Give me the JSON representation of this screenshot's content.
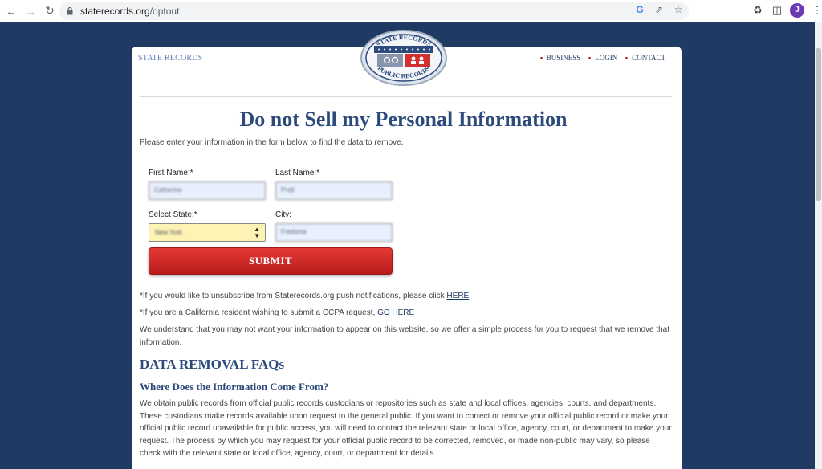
{
  "browser": {
    "url_domain": "staterecords.org",
    "url_path": "/optout",
    "avatar_initial": "J"
  },
  "header": {
    "site_name": "STATE RECORDS",
    "logo_top_text": "STATE RECORDS",
    "logo_bottom_text": "PUBLIC RECORDS",
    "nav": [
      {
        "label": "BUSINESS"
      },
      {
        "label": "LOGIN"
      },
      {
        "label": "CONTACT"
      }
    ]
  },
  "main": {
    "title": "Do not Sell my Personal Information",
    "intro": "Please enter your information in the form below to find the data to remove.",
    "form": {
      "first_name_label": "First Name:*",
      "first_name_value": "Catherine",
      "last_name_label": "Last Name:*",
      "last_name_value": "Pratt",
      "state_label": "Select State:*",
      "state_value": "New York",
      "city_label": "City:",
      "city_value": "Fredonia",
      "submit_label": "SUBMIT"
    },
    "unsubscribe_text": "*If you would like to unsubscribe from Staterecords.org push notifications, please click ",
    "unsubscribe_link": "HERE",
    "ccpa_text": "*If you are a California resident wishing to submit a CCPA request, ",
    "ccpa_link": "GO HERE",
    "removal_paragraph": "We understand that you may not want your information to appear on this website, so we offer a simple process for you to request that we remove that information.",
    "faq_heading": "DATA REMOVAL FAQs",
    "faq_q1": "Where Does the Information Come From?",
    "faq_a1": "We obtain public records from official public records custodians or repositories such as state and local offices, agencies, courts, and departments. These custodians make records available upon request to the general public. If you want to correct or remove your official public record or make your official public record unavailable for public access, you will need to contact the relevant state or local office, agency, court, or department to make your request. The process by which you may request for your official public record to be corrected, removed, or made non-public may vary, so please check with the relevant state or local office, agency, court, or department for details."
  },
  "colors": {
    "page_background": "#1f3a63",
    "accent_red": "#d32f2f",
    "heading_blue": "#2c4a7c"
  }
}
